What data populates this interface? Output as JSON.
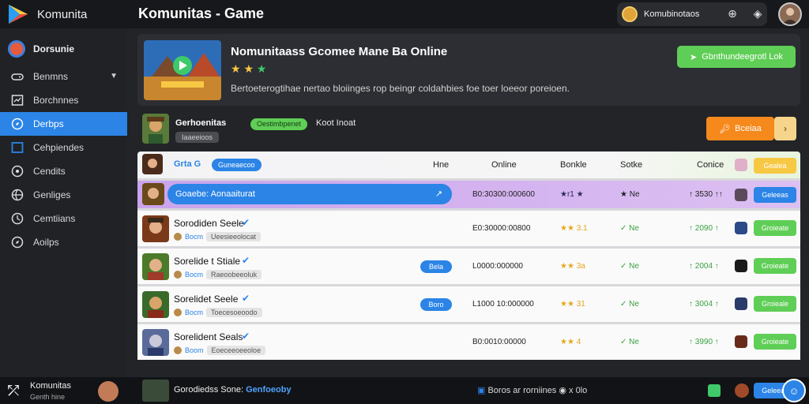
{
  "app": {
    "brand": "Komunita",
    "page_title": "Komunitas - Game"
  },
  "account": {
    "name": "Komubinotaos"
  },
  "sidebar": {
    "user": "Dorsunie",
    "items": [
      {
        "label": "Benmns",
        "icon": "gamepad-icon",
        "active": false
      },
      {
        "label": "Borchnnes",
        "icon": "chart-icon",
        "active": false
      },
      {
        "label": "Derbps",
        "icon": "compass-icon",
        "active": true
      },
      {
        "label": "Cehpiendes",
        "icon": "square-icon",
        "active": false
      },
      {
        "label": "Cendits",
        "icon": "target-icon",
        "active": false
      },
      {
        "label": "Genliges",
        "icon": "globe-icon",
        "active": false
      },
      {
        "label": "Cemtiians",
        "icon": "clock-icon",
        "active": false
      },
      {
        "label": "Aoilps",
        "icon": "compass-icon",
        "active": false
      }
    ]
  },
  "hero": {
    "title": "Nomunitaass Gcomee Mane Ba Online",
    "rating": 3,
    "description": "Bertoeterogtihae nertao bloiinges rop beingr coldahbies foe toer loeeor poreioen.",
    "button": "Gbnthundeegrotl Lok"
  },
  "group": {
    "name": "Gerhoenitas",
    "tag": "Oestimbpenet",
    "extra": "Koot Inoat",
    "sub": "Iaaeeioos",
    "button": "Bceiaa",
    "button2": "›"
  },
  "table": {
    "headers": {
      "name": "Grta G",
      "tag": "Guneaecoo",
      "c1": "Hne",
      "c2": "Online",
      "c3": "Bonkle",
      "c4": "Sotke",
      "c5": "Conice",
      "action": "Gealea"
    },
    "featured": {
      "name": "Goaebe: Aonaaiturat",
      "time": "B0:30300:000600",
      "rating": "★r1 ★",
      "status": "★ Ne",
      "score": "↑ 3530 ↑↑",
      "button": "Geleeas"
    },
    "rows": [
      {
        "name": "Sorodiden Seele",
        "sub": "Bocm",
        "tag": "Ueesieeolocat",
        "badge": "",
        "time": "E0:30000:00800",
        "rating": "★★ 3.1",
        "status": "✓ Ne",
        "score": "↑ 2090 ↑",
        "button": "Groieate"
      },
      {
        "name": "Sorelide t Stiale",
        "sub": "Bocm",
        "tag": "Raeoobeeoluk",
        "badge": "Bela",
        "time": "L0000:000000",
        "rating": "★★ 3a",
        "status": "✓ Ne",
        "score": "↑ 2004 ↑",
        "button": "Groieate"
      },
      {
        "name": "Sorelidet Seele",
        "sub": "Bocm",
        "tag": "Toecesoeoodo",
        "badge": "Boro",
        "time": "L1000 10:000000",
        "rating": "★★ 31",
        "status": "✓ Ne",
        "score": "↑ 3004 ↑",
        "button": "Groieale"
      },
      {
        "name": "Sorelident Seals",
        "sub": "Boom",
        "tag": "Eoeceeoeeoloe",
        "badge": "",
        "time": "B0:0010:00000",
        "rating": "★★ 4",
        "status": "✓ Ne",
        "score": "↑ 3990 ↑",
        "button": "Groieate"
      }
    ]
  },
  "footer": {
    "brand": "Komunitas",
    "brand_sub": "Genth hine",
    "game": "Gorodiedss Sone:",
    "game_tag": "Genfoeoby",
    "status": "Boros ar rorniines",
    "status2": "x 0lo",
    "button": "Geleeas"
  },
  "colors": {
    "accent": "#2b84e6",
    "success": "#5fce56",
    "warning": "#f5891c",
    "featured": "#caa4ec"
  }
}
